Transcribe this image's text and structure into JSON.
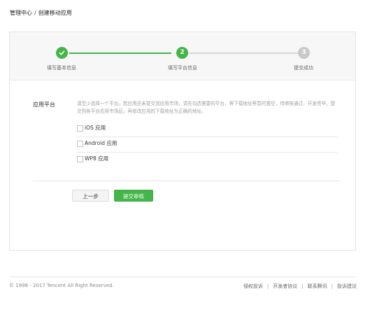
{
  "breadcrumb": {
    "parent": "管理中心",
    "separator": "/",
    "current": "创建移动应用"
  },
  "steps": [
    {
      "label": "填写基本信息",
      "number": "1",
      "status": "done"
    },
    {
      "label": "填写平台信息",
      "number": "2",
      "status": "active"
    },
    {
      "label": "提交成功",
      "number": "3",
      "status": "todo"
    }
  ],
  "form": {
    "label": "应用平台",
    "hint": "请至少选择一个平台。若应用还未提交到应用市场，请先勾选需要的平台，将下载地址等暂时置空，待审核通过、开发完毕，提交到各平台应用市场后，再修改应用的下载地址为正确的地址。",
    "options": [
      {
        "label": "iOS 应用",
        "checked": false
      },
      {
        "label": "Android 应用",
        "checked": false
      },
      {
        "label": "WP8 应用",
        "checked": false
      }
    ]
  },
  "buttons": {
    "prev": "上一步",
    "submit": "提交审核"
  },
  "footer": {
    "copyright": "© 1998 - 2017 Tencent All Right Reserved.",
    "links": [
      "侵权投诉",
      "开发者协议",
      "联系腾讯",
      "投诉建议"
    ],
    "separator": "|"
  },
  "colors": {
    "accent": "#44b549",
    "todo": "#c9c9c9"
  }
}
